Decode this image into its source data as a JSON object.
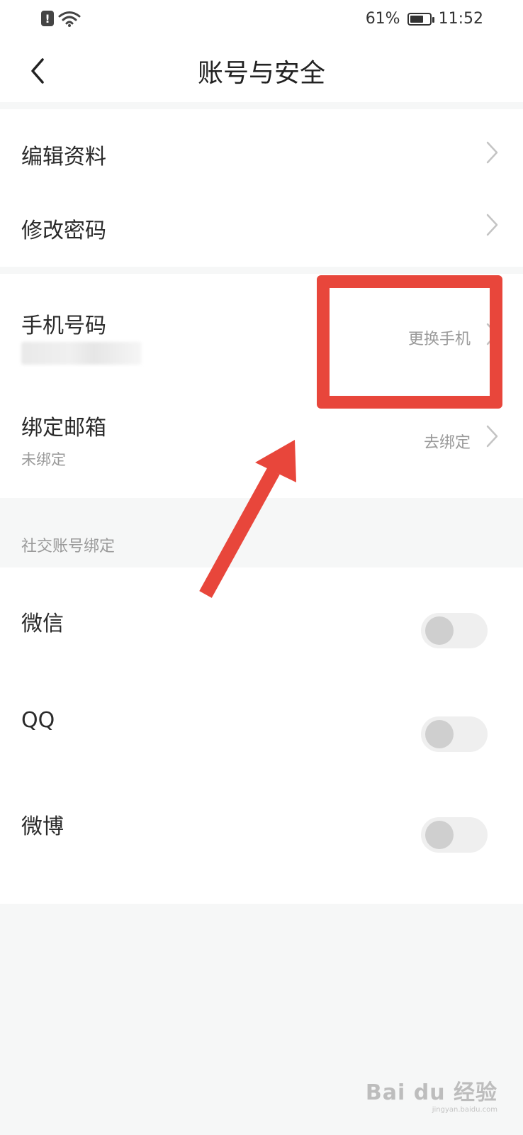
{
  "status_bar": {
    "battery_percent": "61%",
    "battery_level": 0.61,
    "time": "11:52",
    "icons": [
      "alert-icon",
      "wifi-icon",
      "battery-icon"
    ]
  },
  "header": {
    "title": "账号与安全",
    "back_icon": "back-chevron-icon"
  },
  "account_group": {
    "items": [
      {
        "label": "编辑资料"
      },
      {
        "label": "修改密码"
      }
    ]
  },
  "contact_group": {
    "phone": {
      "label": "手机号码",
      "action": "更换手机"
    },
    "email": {
      "label": "绑定邮箱",
      "status": "未绑定",
      "action": "去绑定"
    }
  },
  "social": {
    "section_title": "社交账号绑定",
    "items": [
      {
        "label": "微信",
        "enabled": false
      },
      {
        "label": "QQ",
        "enabled": false
      },
      {
        "label": "微博",
        "enabled": false
      }
    ]
  },
  "annotation": {
    "color": "#e8463b"
  },
  "watermark": {
    "main": "Bai du 经验",
    "sub": "jingyan.baidu.com"
  },
  "colors": {
    "background": "#f6f7f7",
    "card": "#ffffff",
    "secondary_text": "#9a9a9a",
    "annotation_red": "#e8463b"
  }
}
